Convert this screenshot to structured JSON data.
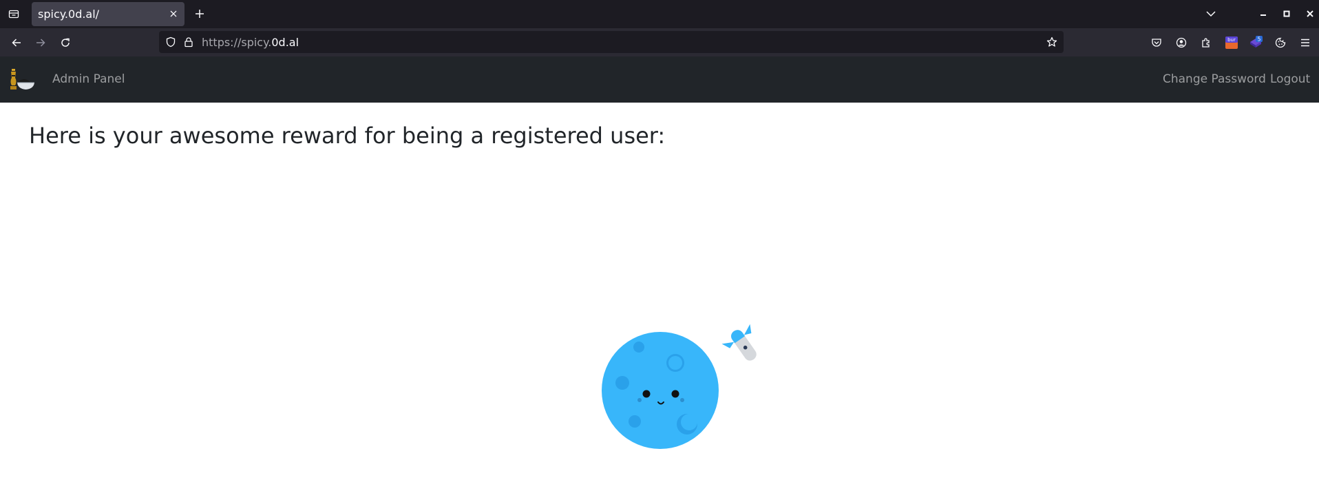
{
  "browser": {
    "tab": {
      "title": "spicy.0d.al/"
    },
    "url": {
      "prefix": "https://spicy.",
      "host": "0d.al"
    },
    "extensions": [
      {
        "icon": "pocket-icon"
      },
      {
        "icon": "account-icon"
      },
      {
        "icon": "extensions-icon"
      },
      {
        "icon": "burp-extension-icon",
        "label": "bur"
      },
      {
        "icon": "violet-extension-icon",
        "badge": "5"
      },
      {
        "icon": "cookie-icon"
      }
    ]
  },
  "site": {
    "nav": {
      "brand_label": "Admin Panel",
      "change_password": "Change Password",
      "logout": "Logout"
    },
    "heading": "Here is your awesome reward for being a registered user:"
  },
  "colors": {
    "titlebar": "#1c1b22",
    "toolbar": "#2b2a33",
    "site_nav": "#212529",
    "planet": "#38b6fa"
  }
}
